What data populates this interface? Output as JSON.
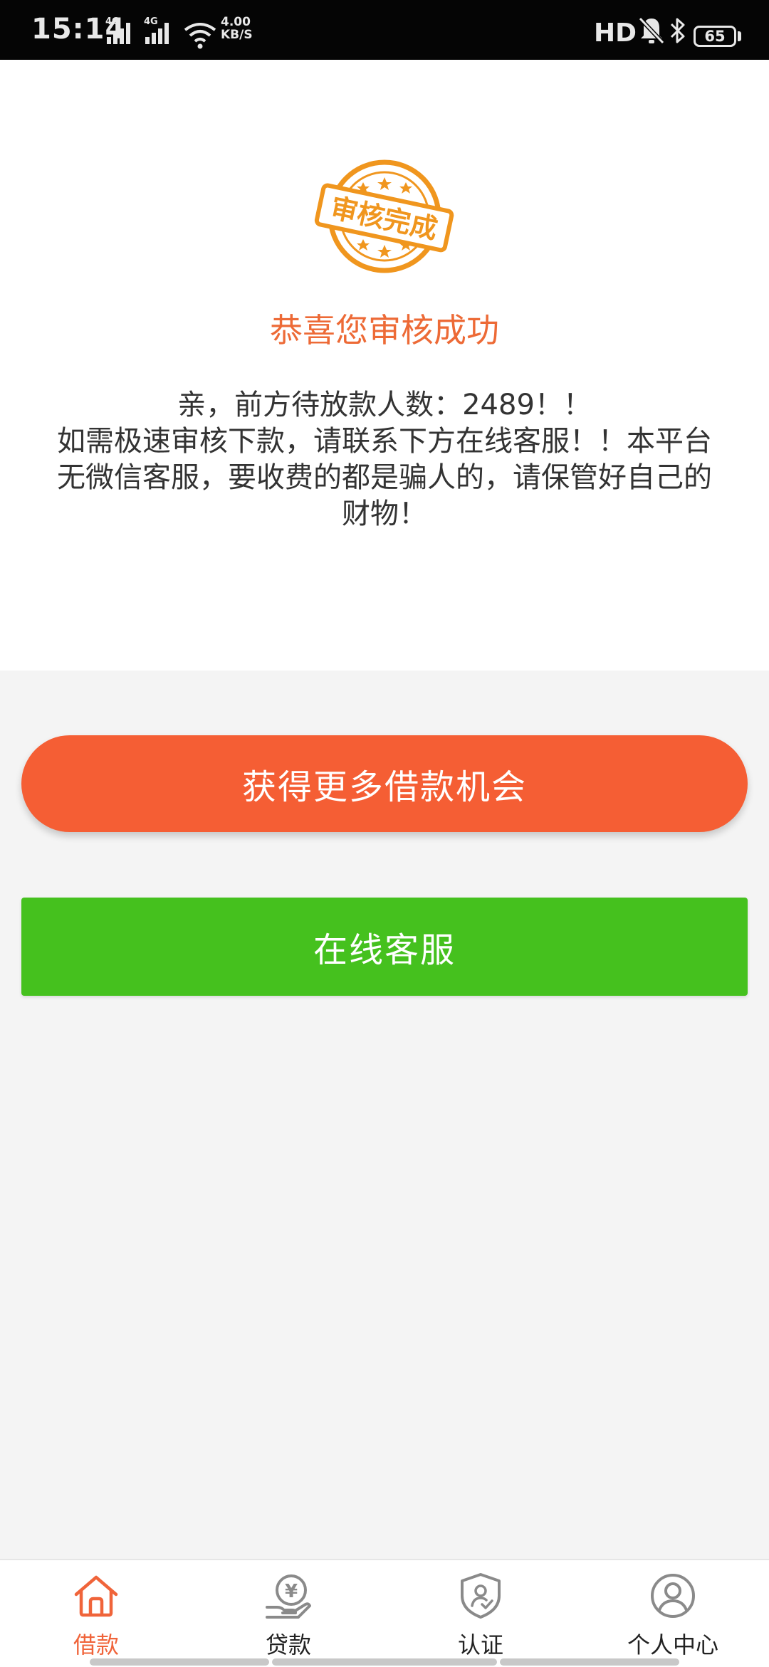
{
  "status_bar": {
    "time": "15:14",
    "network1": "4G",
    "network2": "4G",
    "speed_value": "4.00",
    "speed_unit": "KB/S",
    "hd_label": "HD",
    "battery": "65"
  },
  "stamp": {
    "text": "审核完成",
    "color": "#f0961e"
  },
  "result": {
    "title": "恭喜您审核成功",
    "notice_lines": [
      "亲，前方待放款人数：2489！！",
      "如需极速审核下款，请联系下方在线客服！！本平台",
      "无微信客服，要收费的都是骗人的，请保管好自己的",
      "财物！"
    ]
  },
  "buttons": {
    "more_chances": "获得更多借款机会",
    "online_service": "在线客服"
  },
  "tabbar": {
    "items": [
      {
        "label": "借款",
        "icon": "home-icon",
        "active": true
      },
      {
        "label": "贷款",
        "icon": "yuan-hand-icon",
        "active": false
      },
      {
        "label": "认证",
        "icon": "shield-user-icon",
        "active": false
      },
      {
        "label": "个人中心",
        "icon": "person-icon",
        "active": false
      }
    ]
  },
  "colors": {
    "accent_orange": "#f55e34",
    "title_orange": "#ed6a36",
    "service_green": "#45c11e",
    "page_bg": "#f4f4f4"
  }
}
